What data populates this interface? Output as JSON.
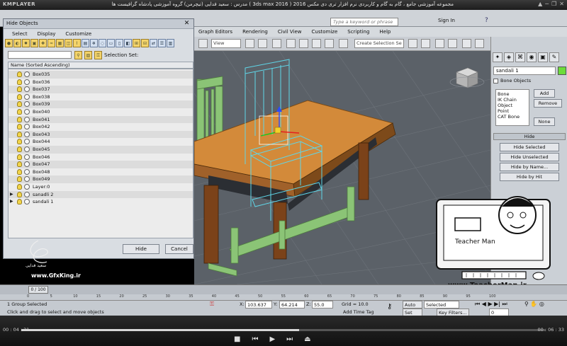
{
  "player": {
    "logo": "KMPLAYER",
    "course_title": "مجموعه آموزشی جامع ، گام به گام و کاربردی نرم افزار تری دی مکس 2016 ( 3ds max 2016 )  مدرس : سعید فدایی (تیچرمن) گروه آموزشی پادشاه گرافیست ها",
    "window_buttons": [
      "▲",
      "─",
      "❐",
      "✕"
    ],
    "current_time": "00 : 04 : 31",
    "duration": "00 : 06 : 33",
    "progress": 0.53
  },
  "app": {
    "search_placeholder": "Type a keyword or phrase",
    "sign_in": "Sign In",
    "help": "?",
    "menu": [
      "Graph Editors",
      "Rendering",
      "Civil View",
      "Customize",
      "Scripting",
      "Help"
    ],
    "toolbar": {
      "view_dropdown": "View",
      "selection_set": "Create Selection Se"
    }
  },
  "dialog": {
    "title": "Hide Objects",
    "close": "✕",
    "menu": [
      "Select",
      "Display",
      "Customize"
    ],
    "selection_set_label": "Selection Set:",
    "column_header": "Name (Sorted Ascending)",
    "rows": [
      {
        "name": "Box035",
        "expand": ""
      },
      {
        "name": "Box036",
        "expand": ""
      },
      {
        "name": "Box037",
        "expand": ""
      },
      {
        "name": "Box038",
        "expand": ""
      },
      {
        "name": "Box039",
        "expand": ""
      },
      {
        "name": "Box040",
        "expand": ""
      },
      {
        "name": "Box041",
        "expand": ""
      },
      {
        "name": "Box042",
        "expand": ""
      },
      {
        "name": "Box043",
        "expand": ""
      },
      {
        "name": "Box044",
        "expand": ""
      },
      {
        "name": "Box045",
        "expand": ""
      },
      {
        "name": "Box046",
        "expand": ""
      },
      {
        "name": "Box047",
        "expand": ""
      },
      {
        "name": "Box048",
        "expand": ""
      },
      {
        "name": "Box049",
        "expand": ""
      },
      {
        "name": "Layer:0",
        "expand": ""
      },
      {
        "name": "sanadli 2",
        "expand": "▶"
      },
      {
        "name": "sandali 1",
        "expand": "▶"
      }
    ],
    "hide_button": "Hide",
    "cancel_button": "Cancel"
  },
  "command_panel": {
    "object_name": "sandali 1",
    "object_color": "#6cdc3a",
    "bone_objects_label": "Bone Objects",
    "bone_list": [
      "Bone",
      "IK Chain Object",
      "Point",
      "CAT Bone"
    ],
    "add": "Add",
    "remove": "Remove",
    "none": "None",
    "hide_rollout": "Hide",
    "hide_selected": "Hide Selected",
    "hide_unselected": "Hide Unselected",
    "hide_by_name": "Hide by Name...",
    "hide_by_hit": "Hide by Hit"
  },
  "timeline": {
    "frame": "0 / 100",
    "ruler_ticks": [
      "0",
      "5",
      "10",
      "15",
      "20",
      "25",
      "30",
      "35",
      "40",
      "45",
      "50",
      "55",
      "60",
      "65",
      "70",
      "75",
      "80",
      "85",
      "90",
      "95",
      "100"
    ]
  },
  "status": {
    "selection": "1 Group Selected",
    "prompt": "Click and drag to select and move objects",
    "x_label": "X:",
    "x": "103.637",
    "y_label": "Y:",
    "y": "64.214",
    "z_label": "Z:",
    "z": "55.0",
    "grid": "Grid = 10.0",
    "add_time_tag": "Add Time Tag",
    "auto_key": "Auto Key",
    "set_key": "Set Key",
    "key_mode": "Selected",
    "key_filters": "Key Filters...",
    "frame_field": "0"
  },
  "overlay": {
    "url": "www.TeacherMan.ir",
    "signature_name": "سعید فدایی",
    "gfx": "www.GfxKing.ir"
  }
}
